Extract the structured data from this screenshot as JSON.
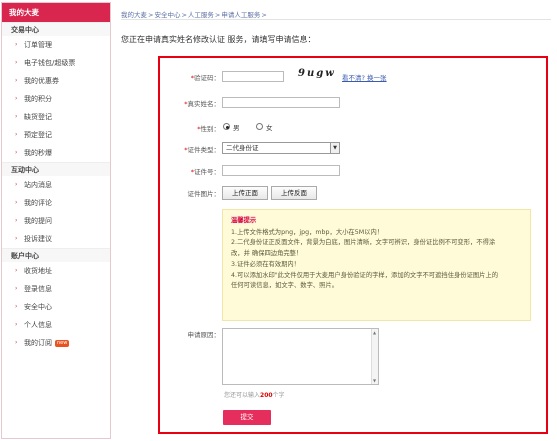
{
  "sidebar": {
    "title": "我的大麦",
    "sections": [
      {
        "title": "交易中心",
        "items": [
          "订单管理",
          "电子钱包/超级票",
          "我的优惠券",
          "我的积分",
          "缺货登记",
          "预定登记",
          "我的秒爆"
        ]
      },
      {
        "title": "互动中心",
        "items": [
          "站内消息",
          "我的评论",
          "我的提问",
          "投诉建议"
        ]
      },
      {
        "title": "账户中心",
        "items": [
          "收货地址",
          "登录信息",
          "安全中心",
          "个人信息",
          "我的订阅"
        ]
      }
    ],
    "new_badge": "new"
  },
  "breadcrumb": [
    "我的大麦",
    ">",
    "安全中心",
    ">",
    "人工服务",
    ">",
    "申请人工服务",
    ">"
  ],
  "page_title": "您正在申请真实姓名修改认证 服务，请填写申请信息：",
  "form": {
    "captcha_label": "验证码：",
    "captcha_text": "9ugw",
    "captcha_link": "看不清? 换一张",
    "name_label": "真实姓名：",
    "gender_label": "性别：",
    "gender_male": "男",
    "gender_female": "女",
    "id_type_label": "证件类型：",
    "id_type_value": "二代身份证",
    "id_no_label": "证件号：",
    "id_img_label": "证件图片：",
    "upload_front": "上传正面",
    "upload_back": "上传反面",
    "reason_label": "申请原因：",
    "hint_prefix": "您还可以输入",
    "hint_count": "200",
    "hint_suffix": "个字",
    "submit": "提交"
  },
  "tips": {
    "title": "温馨提示",
    "lines": [
      "1.上传文件格式为png，jpg，mbp，大小在5M以内！",
      "2.二代身份证正反面文件，背景为白底，图片清晰，文字可辨识，身份证比例不可变形，不得涂",
      "改，并 确保四边角完整！",
      "3.证件必须在有效期内！",
      "4.可以添加水印\"此文件仅用于大麦用户身份验证的字样，添加的文字不可遮挡住身份证图片上的",
      "任何可读信息，如文字、数字、照片。"
    ]
  }
}
